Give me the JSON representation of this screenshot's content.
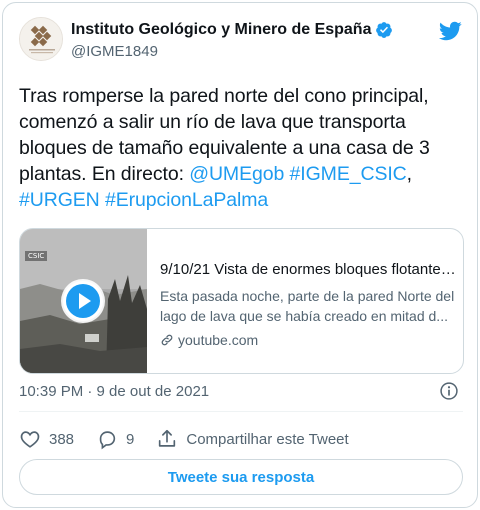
{
  "account": {
    "name": "Instituto Geológico y Minero de España",
    "handle": "@IGME1849"
  },
  "tweet": {
    "text_plain": "Tras romperse la pared norte del cono principal, comenzó a salir un río de lava que transporta bloques de tamaño equivalente a una casa de 3 plantas. En directo: ",
    "mentions": {
      "m1": "@UMEgob",
      "h1": "#IGME_CSIC",
      "h2": "#URGEN",
      "h3": "#ErupcionLaPalma"
    }
  },
  "media_card": {
    "thumb_label": "CSIC",
    "title": "9/10/21 Vista de enormes bloques flotantes ...",
    "desc_line1": "Esta pasada noche, parte de la pared Norte del",
    "desc_line2": "lago de lava que se había creado en mitad d...",
    "domain": "youtube.com"
  },
  "meta": {
    "timestamp": "10:39 PM · 9 de out de 2021"
  },
  "actions": {
    "likes": "388",
    "replies": "9",
    "share_label": "Compartilhar este Tweet"
  },
  "reply_button": "Tweete sua resposta",
  "colors": {
    "accent": "#1d9bf0",
    "text": "#0f1419",
    "muted": "#536471",
    "border": "#cfd9de"
  },
  "icons": [
    "verified-badge-icon",
    "twitter-bird-icon",
    "play-icon",
    "link-icon",
    "info-icon",
    "heart-icon",
    "reply-bubble-icon",
    "share-icon"
  ]
}
